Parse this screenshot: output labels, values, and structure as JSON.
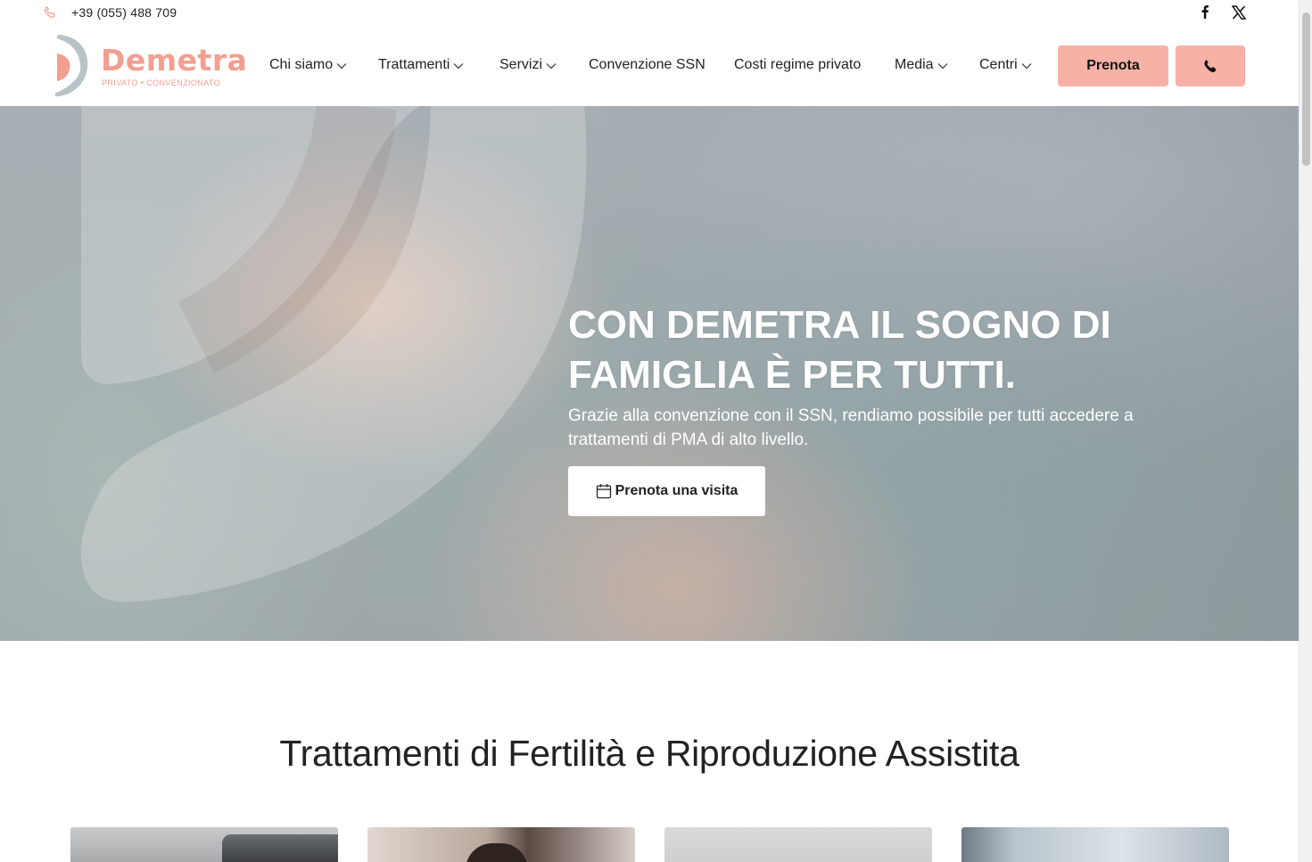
{
  "topbar": {
    "phone": "+39 (055) 488 709",
    "phone_icon": "phone-icon",
    "social": [
      "facebook-icon",
      "x-twitter-icon"
    ]
  },
  "header": {
    "logo": {
      "name": "Demetra",
      "tagline": "PRIVATO • CONVENZIONATO"
    },
    "nav": [
      {
        "label": "Chi siamo",
        "has_dropdown": true
      },
      {
        "label": "Trattamenti",
        "has_dropdown": true
      },
      {
        "label": "Servizi",
        "has_dropdown": true
      },
      {
        "label": "Convenzione SSN",
        "has_dropdown": false
      },
      {
        "label": "Costi regime privato",
        "has_dropdown": false
      },
      {
        "label": "Media",
        "has_dropdown": true
      },
      {
        "label": "Centri",
        "has_dropdown": true
      }
    ],
    "book_button": "Prenota",
    "call_button_icon": "phone-icon"
  },
  "hero": {
    "title_line1": "CON DEMETRA IL SOGNO DI",
    "title_line2": "FAMIGLIA È PER TUTTI.",
    "subtitle_line1": "Grazie alla convenzione con il SSN, rendiamo possibile per tutti accedere a",
    "subtitle_line2": "trattamenti di PMA di alto livello.",
    "cta": "Prenota una visita",
    "cta_icon": "calendar-icon"
  },
  "section": {
    "title": "Trattamenti di Fertilità e Riproduzione Assistita",
    "cards_count_visible": 4
  },
  "colors": {
    "accent": "#f7b1a7",
    "logo": "#f29f91",
    "text": "#222222"
  }
}
